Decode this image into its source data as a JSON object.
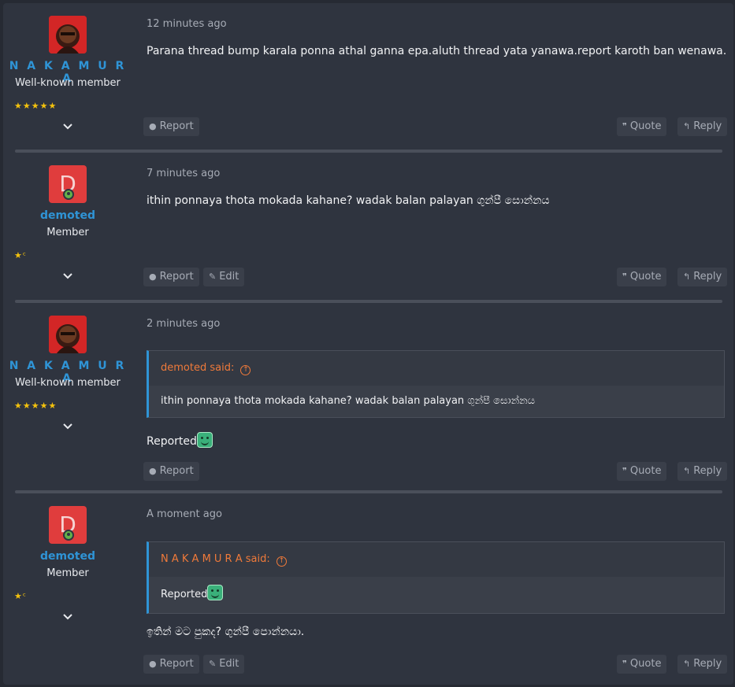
{
  "posts": [
    {
      "author": "N A K A M U R A",
      "user_title": "Well-known member",
      "stars": "★★★★★",
      "time": "12 minutes ago",
      "body": "Parana thread bump karala ponna athal ganna epa.aluth thread yata yanawa.report karoth ban wenawa.",
      "actions": {
        "report": "Report",
        "quote": "Quote",
        "reply": "Reply"
      }
    },
    {
      "author": "demoted",
      "avatar_letter": "D",
      "user_title": "Member",
      "stars": "★ᶜ",
      "time": "7 minutes ago",
      "body": "ithin ponnaya thota mokada kahane? wadak balan palayan ගුන්පී සොන්නය",
      "actions": {
        "report": "Report",
        "edit": "Edit",
        "quote": "Quote",
        "reply": "Reply"
      }
    },
    {
      "author": "N A K A M U R A",
      "user_title": "Well-known member",
      "stars": "★★★★★",
      "time": "2 minutes ago",
      "quote": {
        "author": "demoted said:",
        "text": "ithin ponnaya thota mokada kahane? wadak balan palayan ගුන්පී සොන්නය"
      },
      "body": "Reported",
      "actions": {
        "report": "Report",
        "quote": "Quote",
        "reply": "Reply"
      }
    },
    {
      "author": "demoted",
      "avatar_letter": "D",
      "user_title": "Member",
      "stars": "★ᶜ",
      "time": "A moment ago",
      "quote": {
        "author": "N A K A M U R A said:",
        "text": "Reported"
      },
      "body": "ඉතින් මට පුකද? ගුන්පී පොන්නයා.",
      "actions": {
        "report": "Report",
        "edit": "Edit",
        "quote": "Quote",
        "reply": "Reply"
      }
    }
  ],
  "icons": {
    "report": "info-circle-icon",
    "edit": "pencil-icon",
    "quote": "quote-icon",
    "reply": "reply-icon",
    "expand": "chevron-down-icon",
    "quote_jump": "arrow-up-circle-icon",
    "smilie": "smile-emoji-icon"
  },
  "colors": {
    "page_bg": "#262a33",
    "post_bg": "#2f343f",
    "username": "#2f94d6",
    "quote_author": "#f07a3a",
    "star": "#f4c20d",
    "avatar_letter_bg": "#e03d3d"
  }
}
